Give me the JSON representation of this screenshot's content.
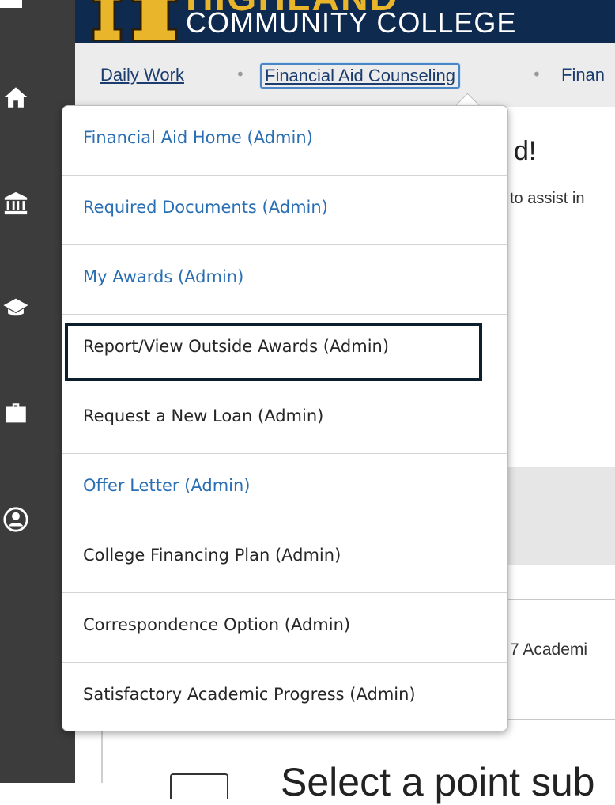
{
  "header": {
    "college_name": "COMMUNITY COLLEGE",
    "logo_letters": "HIGHLAND"
  },
  "breadcrumb": {
    "items": [
      "Daily Work",
      "Financial Aid Counseling",
      "Finan"
    ]
  },
  "background": {
    "heading_fragment": "d!",
    "subtext_fragment": "to assist in",
    "academic_fragment": "7 Academi",
    "bottom_text_fragment": "Select a point sub"
  },
  "menu": {
    "items": [
      {
        "label": "Financial Aid Home (Admin)",
        "style": "link"
      },
      {
        "label": "Required Documents (Admin)",
        "style": "link"
      },
      {
        "label": "My Awards (Admin)",
        "style": "link"
      },
      {
        "label": "Report/View Outside Awards (Admin)",
        "style": "plain",
        "focused": true
      },
      {
        "label": "Request a New Loan (Admin)",
        "style": "plain"
      },
      {
        "label": "Offer Letter (Admin)",
        "style": "link"
      },
      {
        "label": "College Financing Plan (Admin)",
        "style": "plain"
      },
      {
        "label": "Correspondence Option (Admin)",
        "style": "plain"
      },
      {
        "label": "Satisfactory Academic Progress (Admin)",
        "style": "plain"
      }
    ]
  },
  "colors": {
    "rail": "#3c3c3c",
    "banner": "#0f2a4f",
    "link": "#2a6fb3",
    "focus_outline": "#0d1f2c"
  },
  "icons": [
    "menu-icon",
    "home-icon",
    "bank-icon",
    "graduation-cap-icon",
    "briefcase-icon",
    "user-circle-icon"
  ]
}
